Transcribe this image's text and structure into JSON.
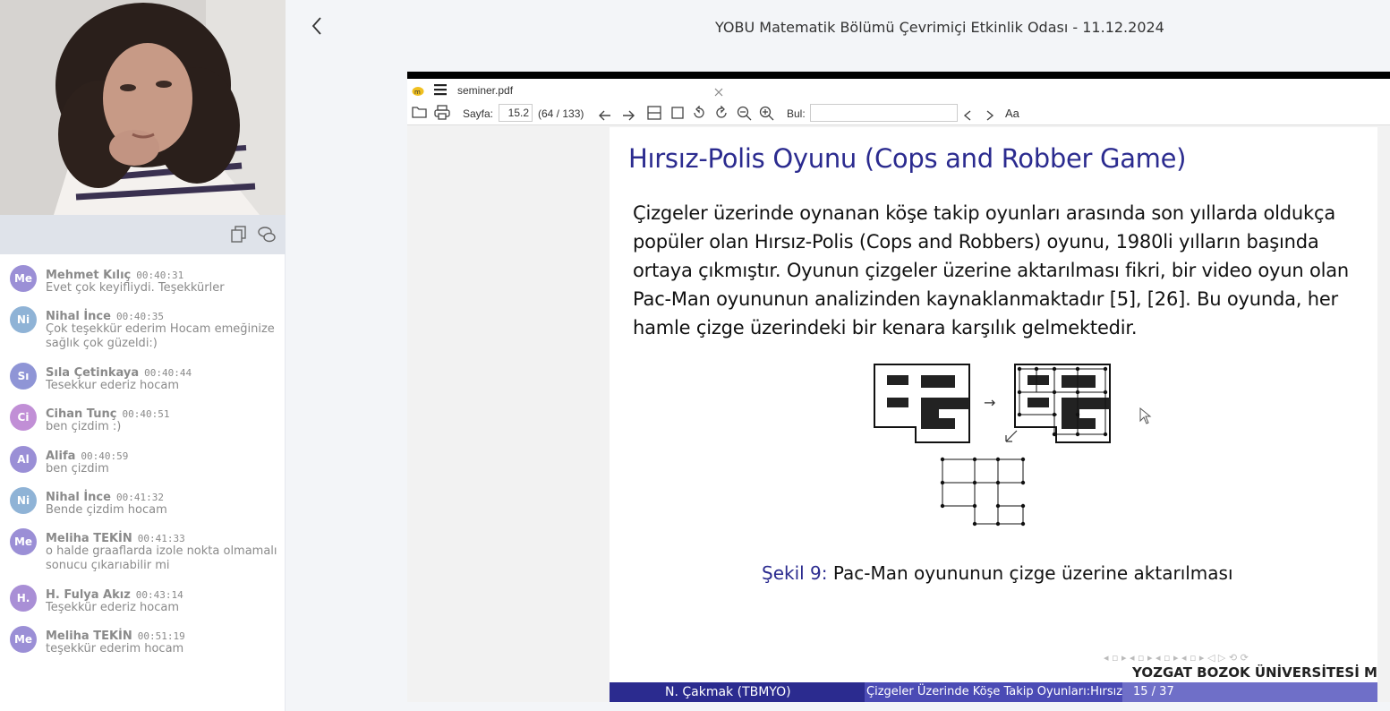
{
  "header": {
    "room_title": "YOBU Matematik Bölümü Çevrimiçi Etkinlik Odası - 11.12.2024"
  },
  "chat": {
    "messages": [
      {
        "initials": "Me",
        "name": "Mehmet Kılıç",
        "time": "00:40:31",
        "text": "Evet çok keyifliydi. Teşekkürler",
        "color": "#9b8fd6"
      },
      {
        "initials": "Ni",
        "name": "Nihal İnce",
        "time": "00:40:35",
        "text": "Çok teşekkür ederim Hocam emeğinize\nsağlık çok güzeldi:)",
        "color": "#8fb3d6"
      },
      {
        "initials": "Sı",
        "name": "Sıla Çetinkaya",
        "time": "00:40:44",
        "text": "Tesekkur ederiz hocam",
        "color": "#8f95d6"
      },
      {
        "initials": "Ci",
        "name": "Cihan Tunç",
        "time": "00:40:51",
        "text": "ben çizdim :)",
        "color": "#c18fd6"
      },
      {
        "initials": "Al",
        "name": "Alifa",
        "time": "00:40:59",
        "text": "ben çizdim",
        "color": "#9a8fd6"
      },
      {
        "initials": "Ni",
        "name": "Nihal İnce",
        "time": "00:41:32",
        "text": "Bende çizdim hocam",
        "color": "#8fb3d6"
      },
      {
        "initials": "Me",
        "name": "Meliha TEKİN",
        "time": "00:41:33",
        "text": "o halde  graaflarda izole nokta olmamalı\nsonucu çıkarıabilir mi",
        "color": "#9b8fd6"
      },
      {
        "initials": "H.",
        "name": "H. Fulya Akız",
        "time": "00:43:14",
        "text": "Teşekkür ederiz hocam",
        "color": "#a98fd6"
      },
      {
        "initials": "Me",
        "name": "Meliha TEKİN",
        "time": "00:51:19",
        "text": "teşekkür ederim hocam",
        "color": "#9b8fd6"
      }
    ]
  },
  "pdf": {
    "filename": "seminer.pdf",
    "page_label": "Sayfa:",
    "page_value": "15.2",
    "page_count": "(64 / 133)",
    "find_label": "Bul:",
    "case_label": "Aa"
  },
  "slide": {
    "title": "Hırsız-Polis Oyunu (Cops and Robber Game)",
    "body": "Çizgeler üzerinde oynanan köşe takip oyunları arasında son yıllarda oldukça popüler olan Hırsız-Polis (Cops and Robbers) oyunu, 1980li yılların başında ortaya çıkmıştır. Oyunun çizgeler üzerine aktarılması fikri, bir video oyun olan Pac-Man oyununun analizinden kaynaklanmaktadır [5], [26]. Bu oyunda, her hamle çizge üzerindeki bir kenara karşılık gelmektedir.",
    "caption_label": "Şekil 9:",
    "caption_text": "Pac-Man oyununun çizge üzerine aktarılması",
    "footer_author": "N. Çakmak  (TBMYO)",
    "footer_title": "Çizgeler Üzerinde Köşe Takip Oyunları:Hırsız-Polis",
    "footer_page": "15 / 37",
    "university": "YOZGAT BOZOK ÜNİVERSİTESİ Matematik"
  }
}
